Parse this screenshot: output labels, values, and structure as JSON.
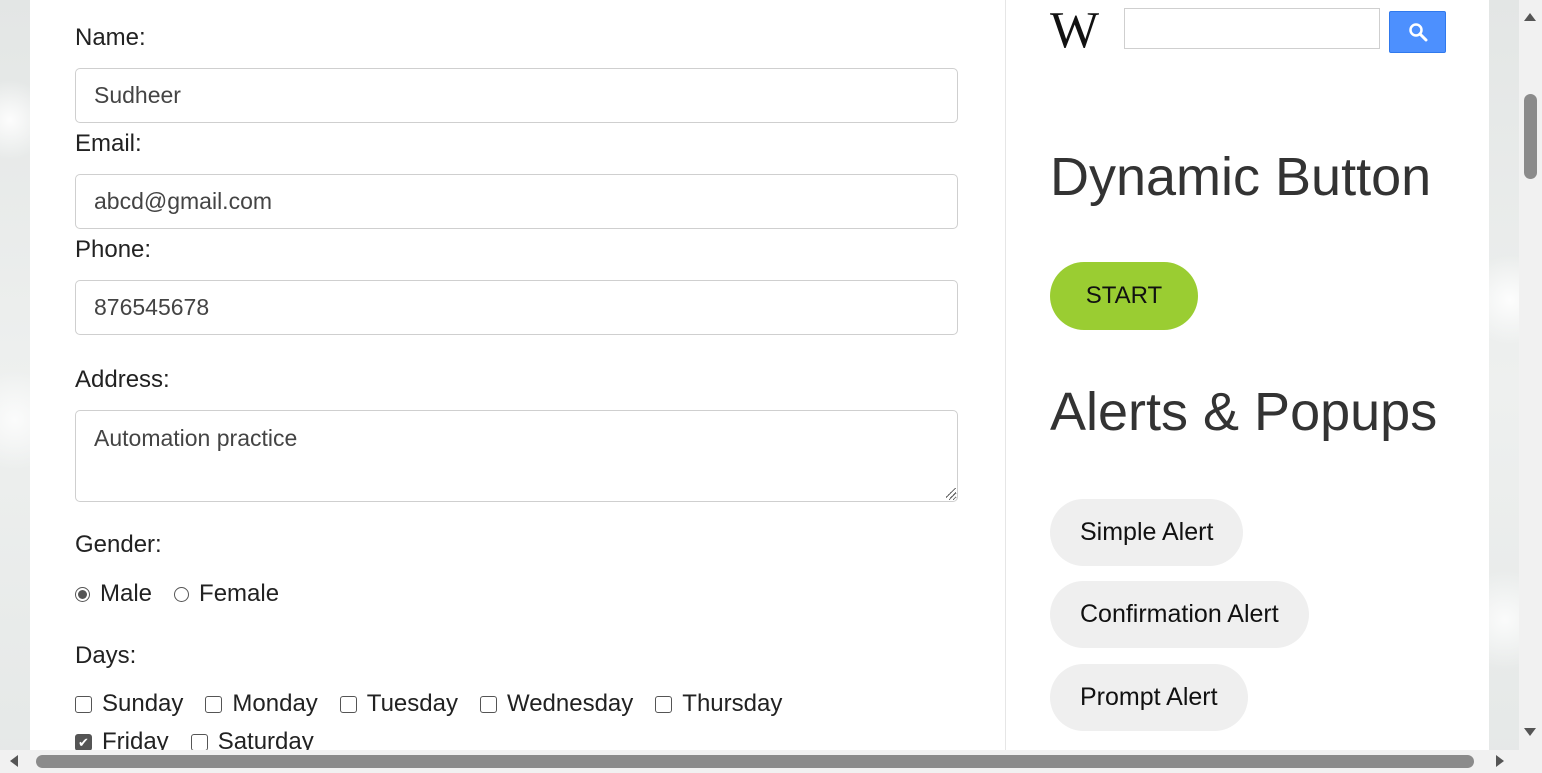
{
  "form": {
    "name_label": "Name:",
    "name_value": "Sudheer",
    "email_label": "Email:",
    "email_value": "abcd@gmail.com",
    "phone_label": "Phone:",
    "phone_value": "876545678",
    "address_label": "Address:",
    "address_value": "Automation practice",
    "gender_label": "Gender:",
    "gender_options": [
      {
        "label": "Male",
        "checked": true
      },
      {
        "label": "Female",
        "checked": false
      }
    ],
    "days_label": "Days:",
    "days": [
      {
        "label": "Sunday",
        "checked": false
      },
      {
        "label": "Monday",
        "checked": false
      },
      {
        "label": "Tuesday",
        "checked": false
      },
      {
        "label": "Wednesday",
        "checked": false
      },
      {
        "label": "Thursday",
        "checked": false
      },
      {
        "label": "Friday",
        "checked": true
      },
      {
        "label": "Saturday",
        "checked": false
      }
    ]
  },
  "sidebar": {
    "wiki_logo": "W",
    "search_icon": "search-icon",
    "dynamic_heading": "Dynamic Button",
    "start_label": "START",
    "alerts_heading": "Alerts & Popups",
    "alert_buttons": [
      "Simple Alert",
      "Confirmation Alert",
      "Prompt Alert"
    ]
  },
  "colors": {
    "start_button": "#9acd32",
    "search_button": "#4d90fe",
    "pill_button": "#efefef"
  }
}
